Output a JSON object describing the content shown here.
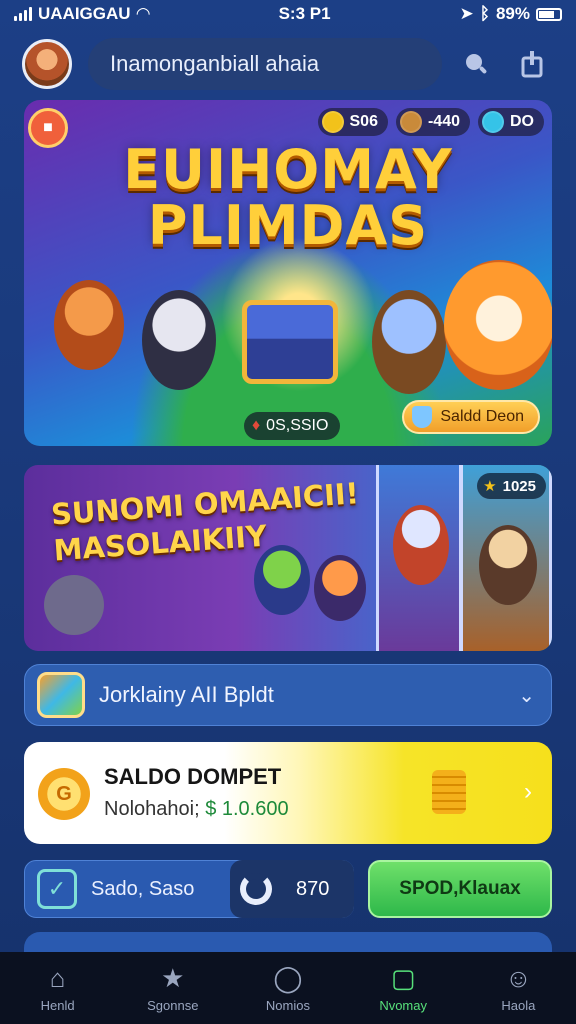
{
  "status_bar": {
    "carrier": "UAAIGGAU",
    "time": "S:3 P1",
    "battery": "89%"
  },
  "header": {
    "app_title": "Inamonganbiall ahaia"
  },
  "banner": {
    "title_line1": "EUIHOMAY",
    "title_line2": "PLIMDAS",
    "currency": [
      {
        "value": "S06",
        "color": "#f2c21a"
      },
      {
        "value": "-440",
        "color": "#c98a3a"
      },
      {
        "value": "DO",
        "color": "#35c3e8"
      }
    ],
    "counter": "0S,SSIO",
    "saldo_button": "Saldd Deon"
  },
  "promo": {
    "title_line1": "SUNOMI OMAAICII!",
    "title_line2": "MASOLAIKIIY",
    "count": "1025"
  },
  "dropdown": {
    "label": "Jorklainy AII Bpldt"
  },
  "wallet": {
    "title": "SALDO DOMPET",
    "label": "Nolohahoi;",
    "amount": "$ 1.0.600"
  },
  "actions": {
    "left_label": "Sado, Saso",
    "mid_value": "870",
    "green_button": "SPOD,Klauax"
  },
  "tabs": [
    {
      "label": "Henld",
      "icon": "home-icon"
    },
    {
      "label": "Sgonnse",
      "icon": "star-icon"
    },
    {
      "label": "Nomios",
      "icon": "clock-icon"
    },
    {
      "label": "Nvomay",
      "icon": "book-icon",
      "active": true
    },
    {
      "label": "Haola",
      "icon": "profile-icon"
    }
  ]
}
